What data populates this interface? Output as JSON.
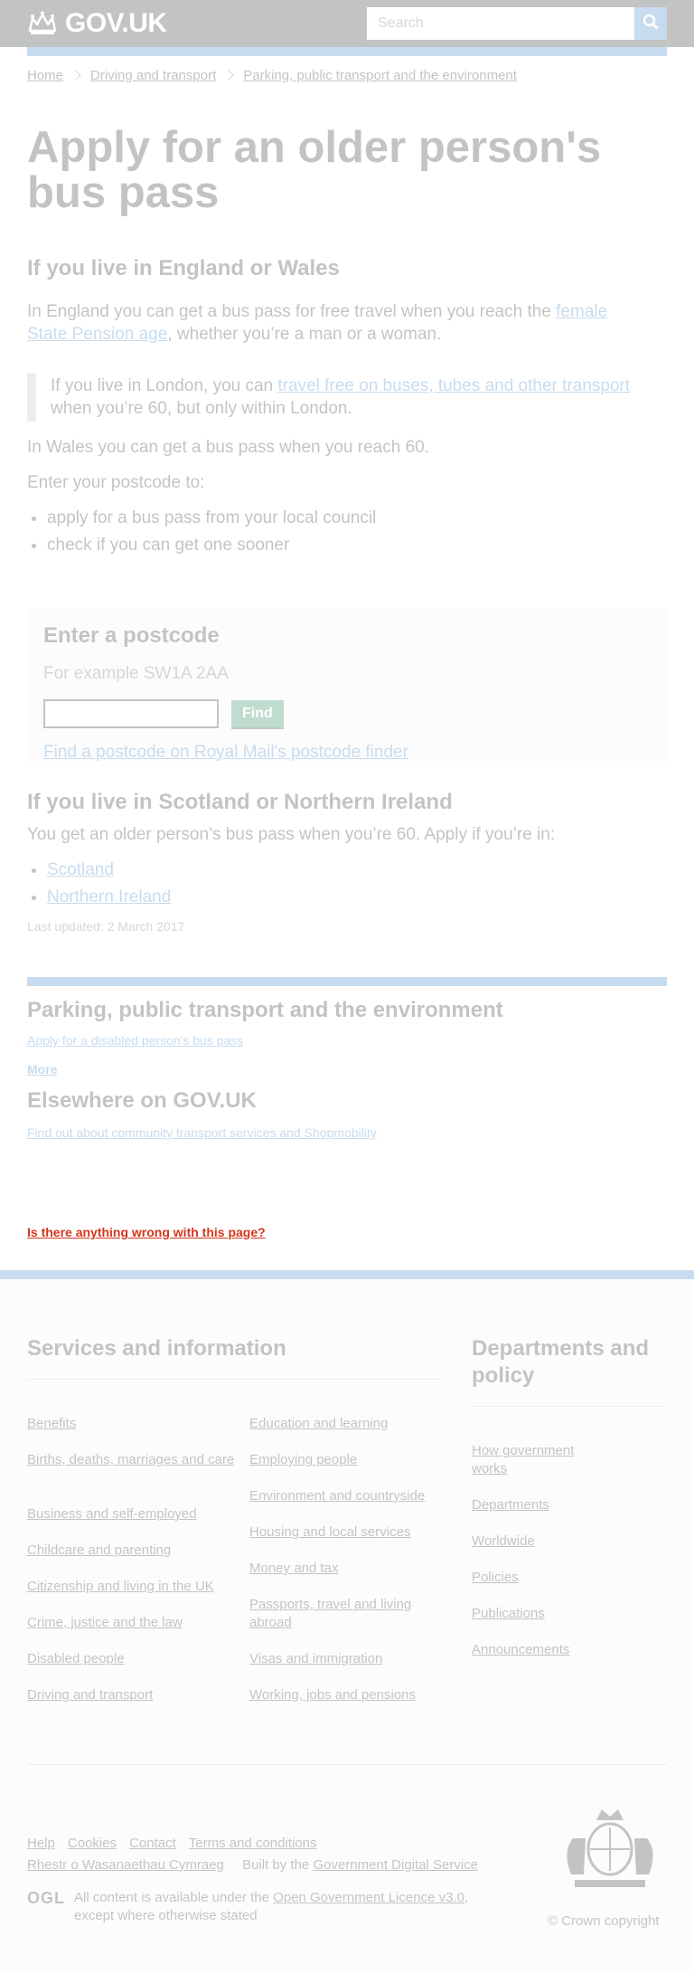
{
  "header": {
    "logo_text": "GOV.UK",
    "search_placeholder": "Search",
    "search_icon": "magnifier-icon"
  },
  "breadcrumbs": [
    "Home",
    "Driving and transport",
    "Parking, public transport and the environment"
  ],
  "page": {
    "title": "Apply for an older person's bus pass",
    "section1_heading": "If you live in England or Wales",
    "england_text_before": "In England you can get a bus pass for free travel when you reach the ",
    "england_link": "female State Pension age",
    "england_text_after": ", whether you’re a man or a woman.",
    "london_text_before": "If you live in London, you can ",
    "london_link": "travel free on buses, tubes and other transport",
    "london_text_after": " when you’re 60, but only within London.",
    "wales_text": "In Wales you can get a bus pass when you reach 60.",
    "enter_postcode_text": "Enter your postcode to:",
    "postcode_bullets": [
      "apply for a bus pass from your local council",
      "check if you can get one sooner"
    ],
    "postcode_box": {
      "heading": "Enter a postcode",
      "example": "For example SW1A 2AA",
      "input_value": "",
      "find_label": "Find",
      "finder_link": "Find a postcode on Royal Mail's postcode finder"
    },
    "section2_heading": "If you live in Scotland or Northern Ireland",
    "section2_text": "You get an older person’s bus pass when you’re 60. Apply if you’re in:",
    "section2_links": [
      "Scotland",
      "Northern Ireland"
    ],
    "last_updated": "Last updated: 2 March 2017"
  },
  "related": {
    "heading": "Parking, public transport and the environment",
    "link": "Apply for a disabled person's bus pass",
    "more": "More",
    "elsewhere_heading": "Elsewhere on GOV.UK",
    "elsewhere_link": "Find out about community transport services and Shopmobility",
    "feedback": "Is there anything wrong with this page?"
  },
  "footer": {
    "services_heading": "Services and information",
    "services_col1": [
      "Benefits",
      "Births, deaths, marriages and care",
      "Business and self-employed",
      "Childcare and parenting",
      "Citizenship and living in the UK",
      "Crime, justice and the law",
      "Disabled people",
      "Driving and transport"
    ],
    "services_col2": [
      "Education and learning",
      "Employing people",
      "Environment and countryside",
      "Housing and local services",
      "Money and tax",
      "Passports, travel and living abroad",
      "Visas and immigration",
      "Working, jobs and pensions"
    ],
    "departments_heading": "Departments and policy",
    "departments": [
      "How government works",
      "Departments",
      "Worldwide",
      "Policies",
      "Publications",
      "Announcements"
    ],
    "meta_links": [
      "Help",
      "Cookies",
      "Contact",
      "Terms and conditions"
    ],
    "welsh_link": "Rhestr o Wasanaethau Cymraeg",
    "built_by_text": "Built by the ",
    "built_by_link": "Government Digital Service",
    "ogl_logo": "OGL",
    "licence_before": "All content is available under the ",
    "licence_link": "Open Government Licence v3.0",
    "licence_after": ", except where otherwise stated",
    "copyright": "© Crown copyright",
    "crest_icon": "royal-coat-of-arms-icon"
  }
}
